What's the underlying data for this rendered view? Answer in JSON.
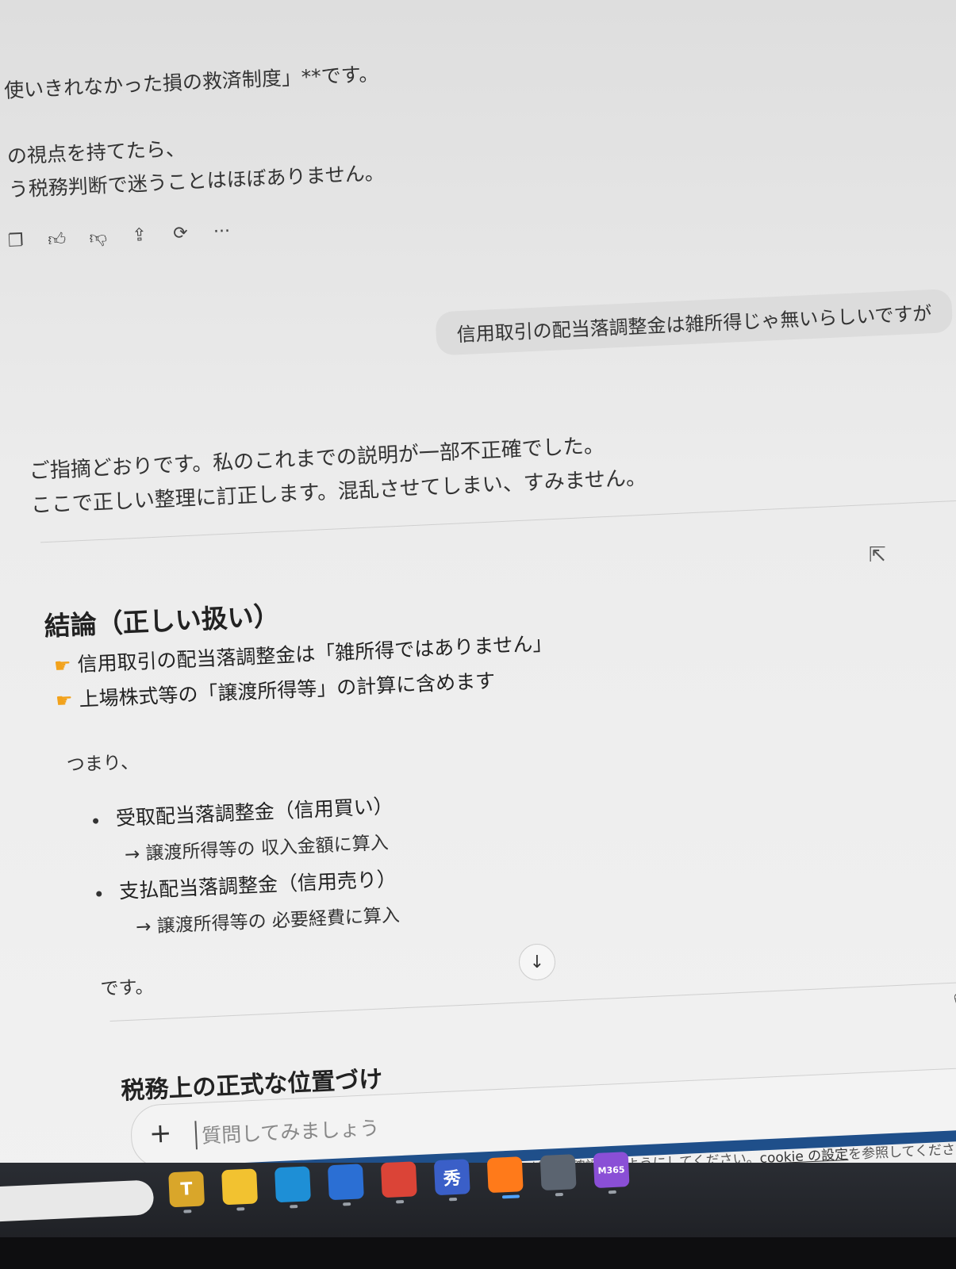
{
  "prev_message": {
    "line1": "使いきれなかった損の救済制度」**です。",
    "line2": "の視点を持てたら、",
    "line3": "う税務判断で迷うことはほぼありません。"
  },
  "actions": {
    "copy_icon": "copy-icon",
    "like_icon": "thumbs-up-icon",
    "dislike_icon": "thumbs-down-icon",
    "share_icon": "share-icon",
    "regenerate_icon": "regenerate-icon",
    "more": "···"
  },
  "user_message": "信用取引の配当落調整金は雑所得じゃ無いらしいですが",
  "reply": {
    "intro1": "ご指摘どおりです。私のこれまでの説明が一部不正確でした。",
    "intro2": "ここで正しい整理に訂正します。混乱させてしまい、すみません。",
    "heading": "結論（正しい扱い）",
    "points": [
      "信用取引の配当落調整金は「雑所得ではありません」",
      "上場株式等の「譲渡所得等」の計算に含めます"
    ],
    "tsumari": "つまり、",
    "items": [
      {
        "title": "受取配当落調整金（信用買い）",
        "detail": "→ 譲渡所得等の 収入金額に算入"
      },
      {
        "title": "支払配当落調整金（信用売り）",
        "detail": "→ 譲渡所得等の 必要経費に算入"
      }
    ],
    "closing": "です。",
    "next_heading": "税務上の正式な位置づけ"
  },
  "composer": {
    "plus": "+",
    "placeholder": "質問してみましょう"
  },
  "footer": {
    "text": "ChatGPT の回答は必ずしも正しいとは限りません。重要な情報は確認するようにしてください。",
    "link": "cookie の設定",
    "tail": "を参照してくださ"
  },
  "taskbar": {
    "apps": [
      {
        "name": "taskbar-app-t",
        "label": "T",
        "color": "#d9a62a"
      },
      {
        "name": "taskbar-app-explorer",
        "label": "",
        "color": "#f2c230"
      },
      {
        "name": "taskbar-app-edge",
        "label": "",
        "color": "#1e8fd6"
      },
      {
        "name": "taskbar-app-store",
        "label": "",
        "color": "#2b6fd4"
      },
      {
        "name": "taskbar-app-chrome",
        "label": "",
        "color": "#db4437"
      },
      {
        "name": "taskbar-app-hide",
        "label": "秀",
        "color": "#3a5fc8"
      },
      {
        "name": "taskbar-app-firefox",
        "label": "",
        "color": "#ff7a1a"
      },
      {
        "name": "taskbar-app-calculator",
        "label": "",
        "color": "#5b6470"
      },
      {
        "name": "taskbar-app-m365",
        "label": "M365",
        "color": "#8a4fd6"
      }
    ]
  }
}
